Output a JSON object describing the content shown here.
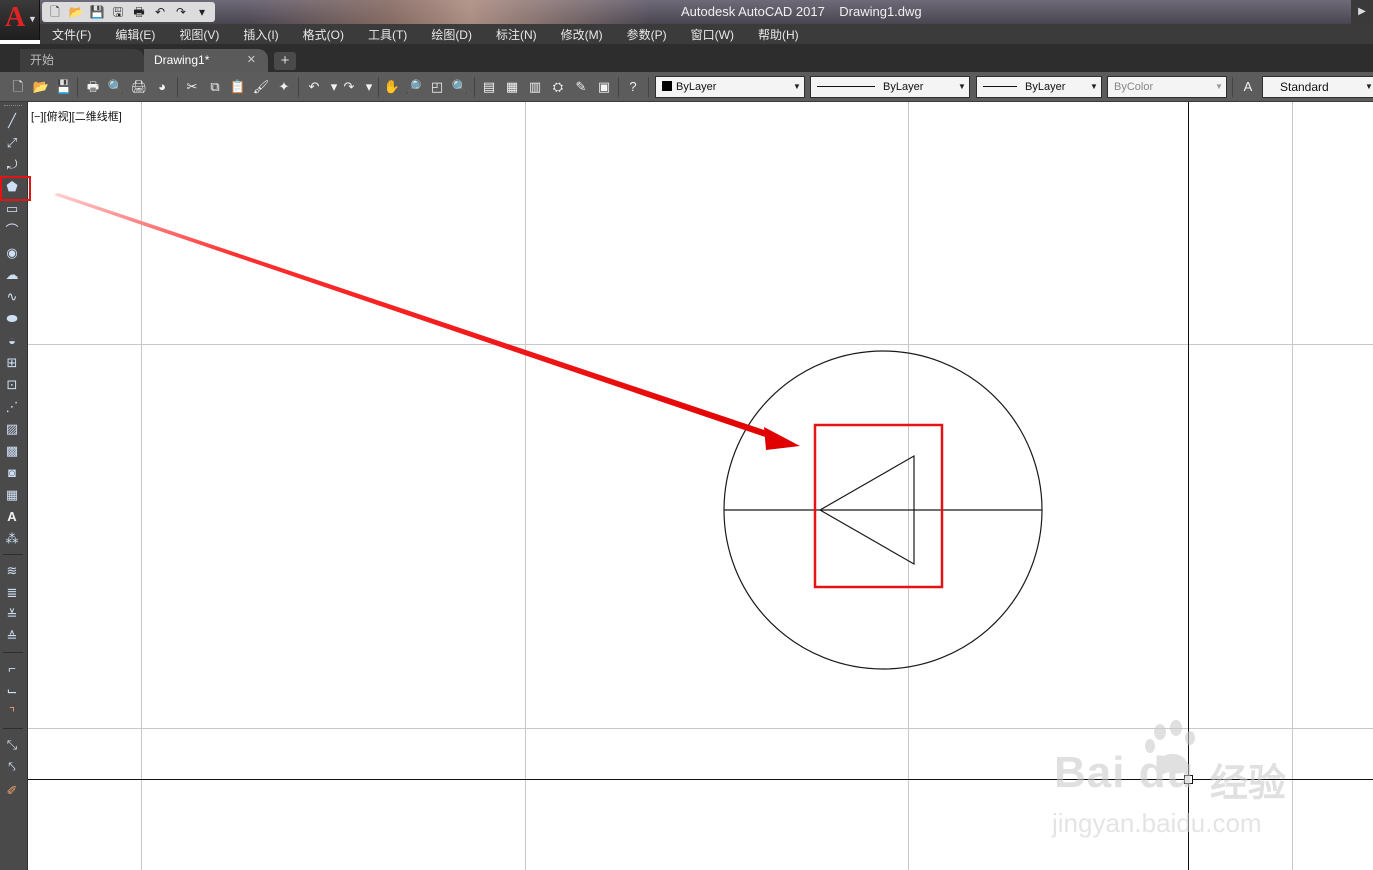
{
  "window": {
    "title": "Autodesk AutoCAD 2017    Drawing1.dwg",
    "app_logo": "A"
  },
  "quick_access": {
    "icons": [
      "new-icon",
      "open-icon",
      "save-icon",
      "save-as-icon",
      "print-icon",
      "undo-icon",
      "redo-icon",
      "customize-icon"
    ]
  },
  "menu": {
    "items": [
      "文件(F)",
      "编辑(E)",
      "视图(V)",
      "插入(I)",
      "格式(O)",
      "工具(T)",
      "绘图(D)",
      "标注(N)",
      "修改(M)",
      "参数(P)",
      "窗口(W)",
      "帮助(H)"
    ]
  },
  "tabs": {
    "start_label": "开始",
    "active_label": "Drawing1*",
    "close_glyph": "✕",
    "add_glyph": "+"
  },
  "toolbar": {
    "layer_color": "ByLayer",
    "linetype": "ByLayer",
    "lineweight": "ByLayer",
    "plot_style": "ByColor",
    "text_style": "Standard"
  },
  "viewport": {
    "label": "[−][俯视][二维线框]"
  },
  "watermark": {
    "logo_text": "Bai  du",
    "cn_text": "经验",
    "url": "jingyan.baidu.com"
  },
  "colors": {
    "accent_red": "#e31414",
    "title_bg": "#5a5560",
    "menu_bg": "#3b3b3b",
    "toolbar_bg": "#5c5c5c",
    "grid": "#c8c8c8"
  }
}
